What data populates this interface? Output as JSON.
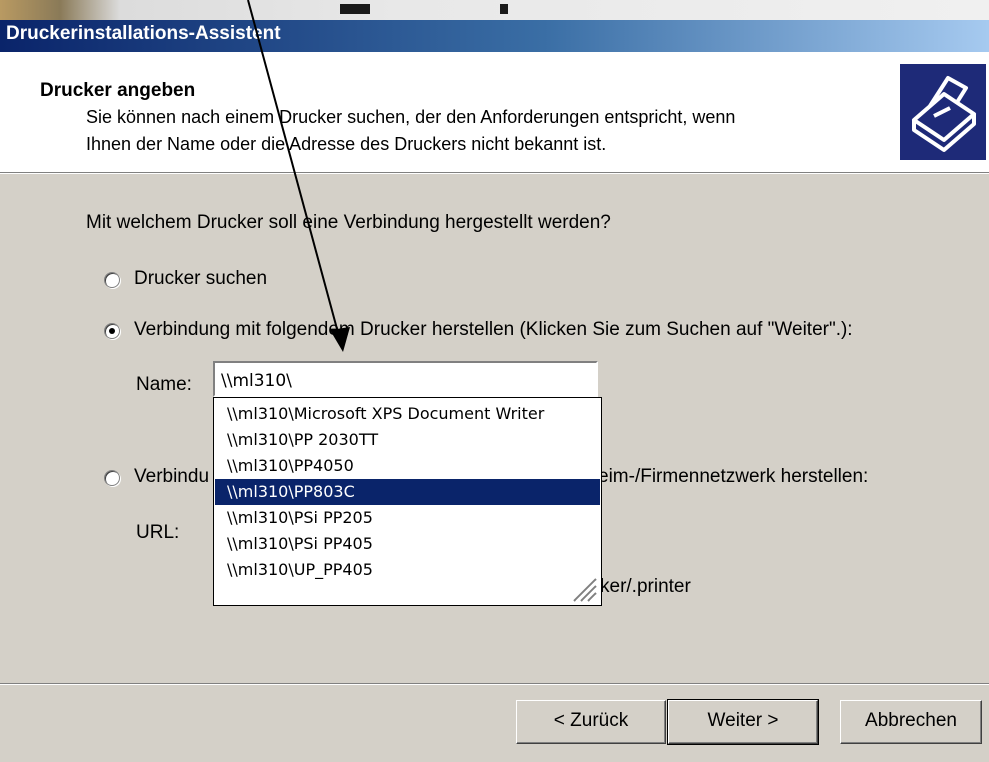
{
  "window": {
    "title": "Druckerinstallations-Assistent"
  },
  "header": {
    "title": "Drucker angeben",
    "description_line1": "Sie können nach einem Drucker suchen, der den Anforderungen entspricht, wenn",
    "description_line2": "Ihnen der Name oder die Adresse des Druckers nicht bekannt ist.",
    "icon": "printer-icon"
  },
  "body": {
    "question": "Mit welchem Drucker soll eine Verbindung hergestellt werden?",
    "options": [
      {
        "label": "Drucker suchen",
        "selected": false
      },
      {
        "label": "Verbindung mit folgendem Drucker herstellen (Klicken Sie zum Suchen auf \"Weiter\".):",
        "selected": true
      },
      {
        "label": "Verbindu",
        "label_tail": "eim-/Firmennetzwerk herstellen:",
        "selected": false
      }
    ],
    "name_label": "Name:",
    "name_value": "\\\\ml310\\",
    "url_label": "URL:",
    "url_example_tail": "ker/.printer"
  },
  "dropdown": {
    "items": [
      "\\\\ml310\\Microsoft XPS Document Writer",
      "\\\\ml310\\PP 2030TT",
      "\\\\ml310\\PP4050",
      "\\\\ml310\\PP803C",
      "\\\\ml310\\PSi PP205",
      "\\\\ml310\\PSi PP405",
      "\\\\ml310\\UP_PP405"
    ],
    "selected_item": "\\\\ml310\\PP803C"
  },
  "buttons": {
    "back": "< Zurück",
    "next": "Weiter >",
    "cancel": "Abbrechen"
  },
  "colors": {
    "titlebar": "#0a246a",
    "selection": "#0a246a",
    "dialog": "#d4d0c8"
  }
}
